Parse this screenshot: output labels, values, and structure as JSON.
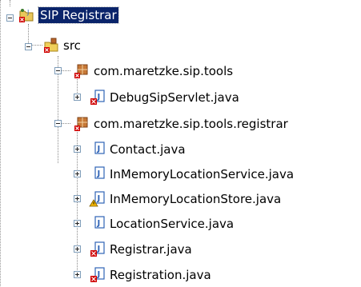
{
  "tree": {
    "project": {
      "label": "SIP Registrar",
      "icon": "java-project-icon",
      "error": true,
      "selected": true
    },
    "source_folder": {
      "label": "src",
      "icon": "source-folder-icon",
      "error": true
    },
    "packages": [
      {
        "label": "com.maretzke.sip.tools",
        "icon": "package-icon",
        "error": true,
        "files": [
          {
            "label": "DebugSipServlet.java",
            "icon": "java-file-icon",
            "status": "error"
          }
        ]
      },
      {
        "label": "com.maretzke.sip.tools.registrar",
        "icon": "package-icon",
        "error": true,
        "files": [
          {
            "label": "Contact.java",
            "icon": "java-file-icon",
            "status": "none"
          },
          {
            "label": "InMemoryLocationService.java",
            "icon": "java-file-icon",
            "status": "none"
          },
          {
            "label": "InMemoryLocationStore.java",
            "icon": "java-file-icon",
            "status": "warning"
          },
          {
            "label": "LocationService.java",
            "icon": "java-file-icon",
            "status": "none"
          },
          {
            "label": "Registrar.java",
            "icon": "java-file-icon",
            "status": "error"
          },
          {
            "label": "Registration.java",
            "icon": "java-file-icon",
            "status": "error"
          }
        ]
      }
    ]
  },
  "colors": {
    "selection_bg": "#0a246a",
    "selection_fg": "#ffffff",
    "error_marker": "#d00000",
    "warning_marker": "#f2b600",
    "package_brown": "#b8652a",
    "java_blue": "#2f63b6"
  }
}
